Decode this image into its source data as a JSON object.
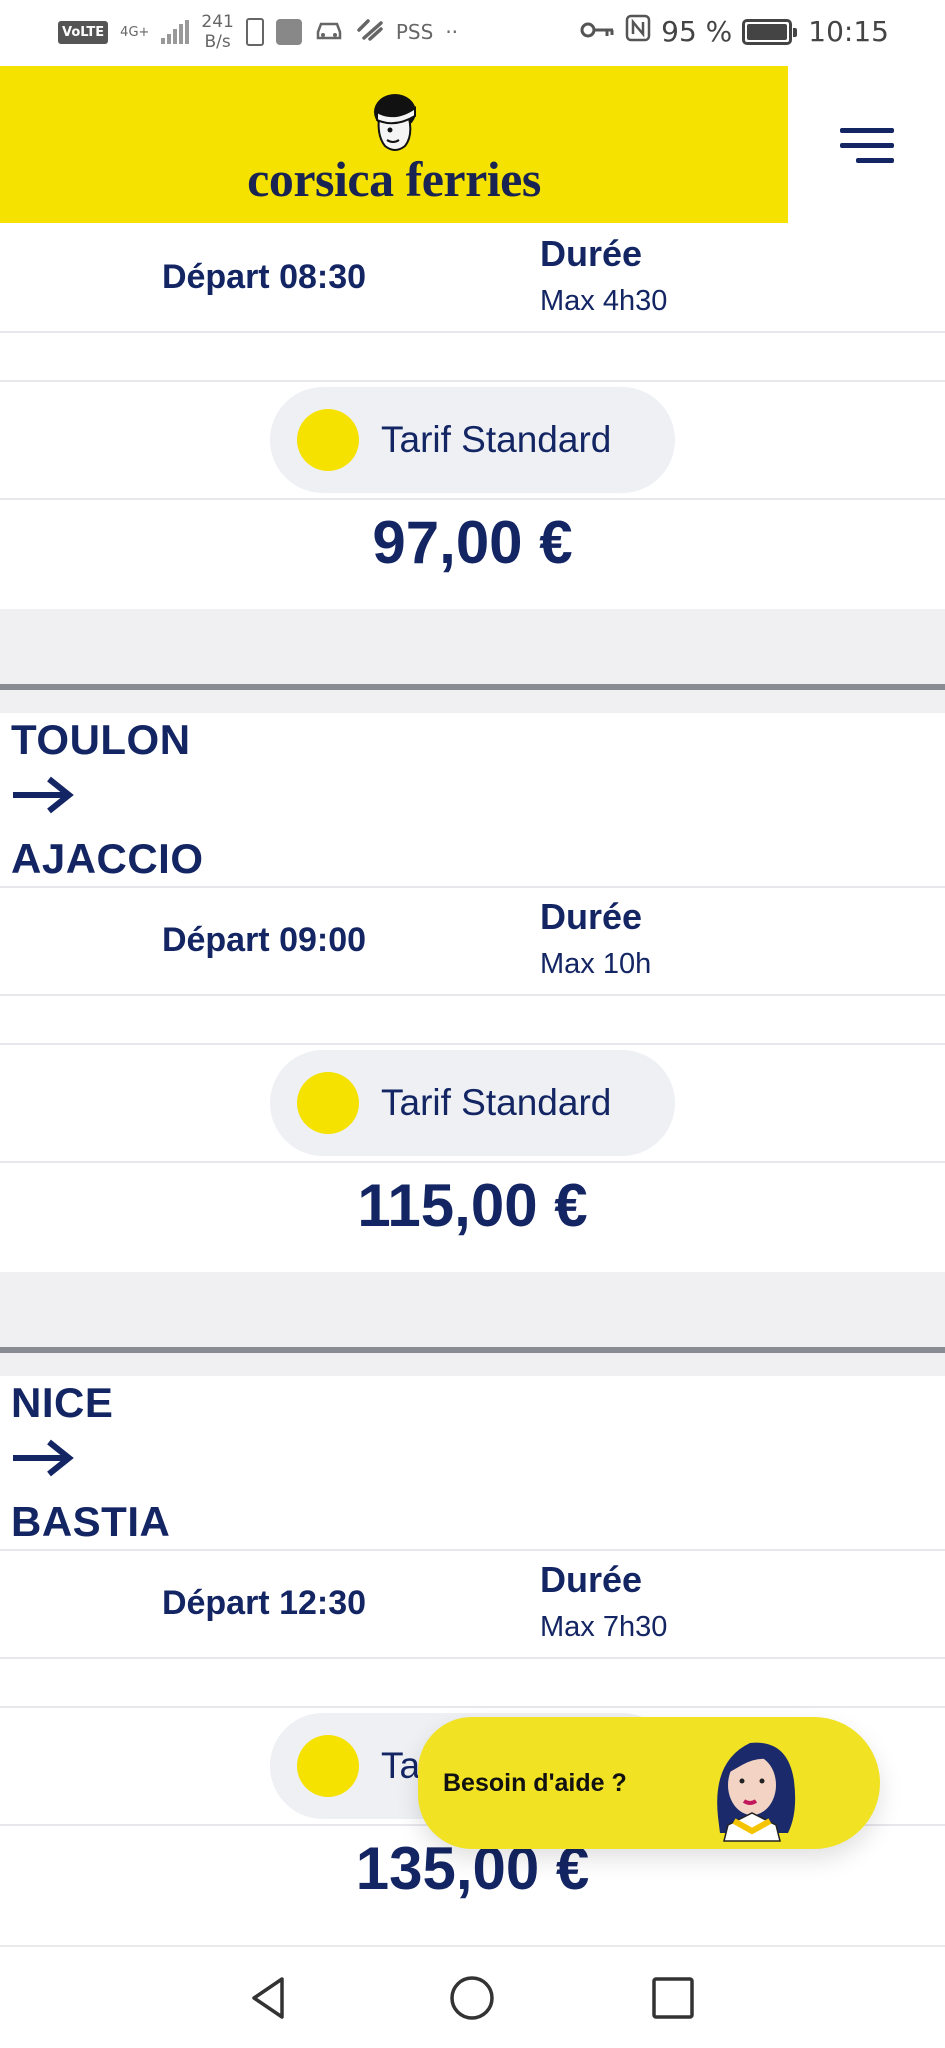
{
  "status_bar": {
    "volte": "VoLTE",
    "network": "4G+",
    "speed_value": "241",
    "speed_unit": "B/s",
    "pss": "PSS",
    "dots": "··",
    "battery": "95 %",
    "battery_level": 0.95,
    "time": "10:15"
  },
  "header": {
    "brand": "corsica ferries",
    "menu_icon": "hamburger-icon",
    "brand_color": "#f5e200"
  },
  "trips": [
    {
      "origin": "",
      "destination": "",
      "depart": "Départ 08:30",
      "duree_label": "Durée",
      "duree_value": "Max 4h30",
      "tarif": "Tarif Standard",
      "price": "97,00 €"
    },
    {
      "origin": "TOULON",
      "destination": "AJACCIO",
      "depart": "Départ 09:00",
      "duree_label": "Durée",
      "duree_value": "Max 10h",
      "tarif": "Tarif Standard",
      "price": "115,00 €"
    },
    {
      "origin": "NICE",
      "destination": "BASTIA",
      "depart": "Départ 12:30",
      "duree_label": "Durée",
      "duree_value": "Max 7h30",
      "tarif": "Tarif Standard",
      "price": "135,00 €"
    }
  ],
  "help": {
    "label": "Besoin d'aide ?"
  },
  "nav": {
    "back": "back-triangle-icon",
    "home": "home-circle-icon",
    "recents": "recents-square-icon"
  },
  "colors": {
    "navy": "#132563",
    "yellow": "#f5e200",
    "pill": "#eef0f4"
  }
}
